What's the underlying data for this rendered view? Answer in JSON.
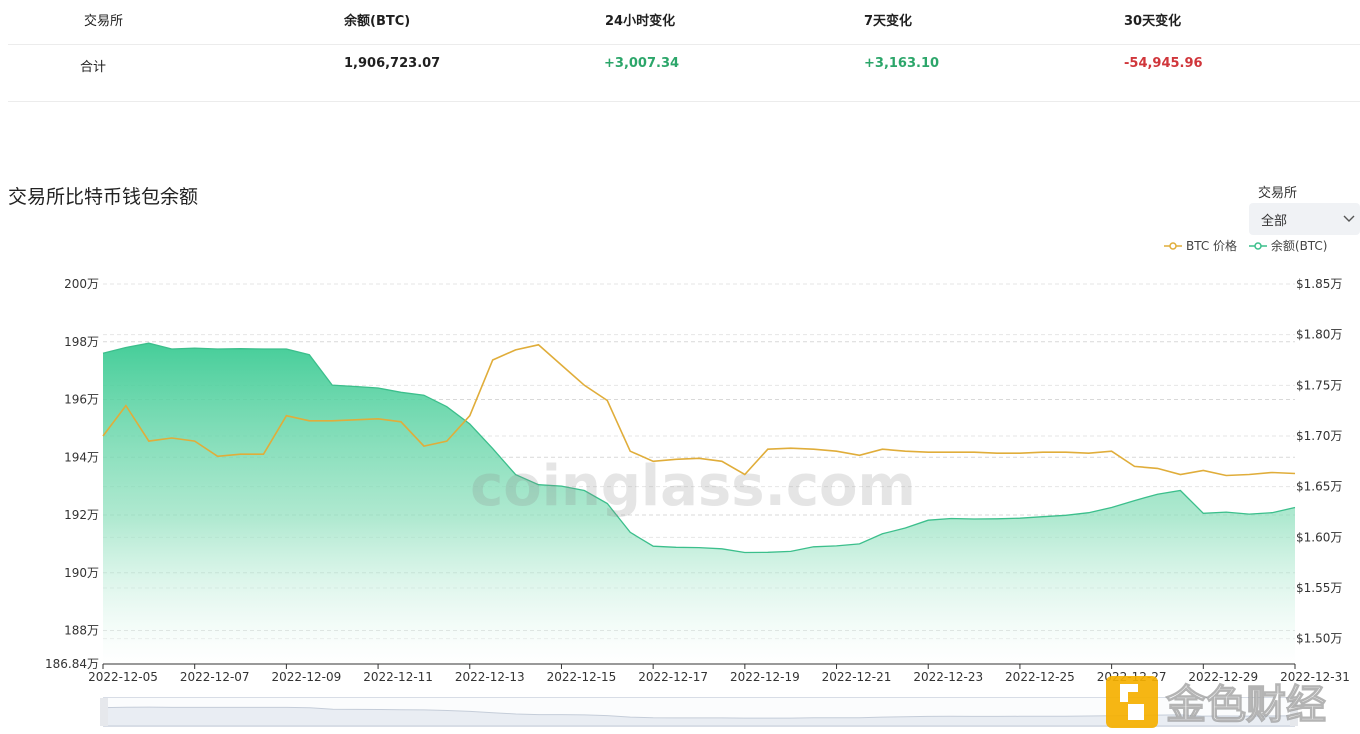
{
  "summary": {
    "headers": {
      "exchange": "交易所",
      "balance": "余额(BTC)",
      "change_24h": "24小时变化",
      "change_7d": "7天变化",
      "change_30d": "30天变化"
    },
    "total_row": {
      "label": "合计",
      "balance": "1,906,723.07",
      "change_24h": "+3,007.34",
      "change_7d": "+3,163.10",
      "change_30d": "-54,945.96"
    }
  },
  "chart_title": "交易所比特币钱包余额",
  "filter": {
    "label": "交易所",
    "value": "全部"
  },
  "watermark": "coinglass.com",
  "logo_text": "金色财经",
  "colors": {
    "btc_price": "#e0ad3a",
    "balance_line": "#3cbf8c",
    "balance_fill_top": "#3ccb94",
    "balance_fill_bottom": "#ffffff",
    "positive": "#2ca66a",
    "negative": "#d0363b"
  },
  "chart_data": {
    "type": "area",
    "title": "交易所比特币钱包余额",
    "legend": [
      "BTC 价格",
      "余额(BTC)"
    ],
    "legend_placement": "top-right",
    "x_tick_labels": [
      "2022-12-05",
      "2022-12-07",
      "2022-12-09",
      "2022-12-11",
      "2022-12-13",
      "2022-12-15",
      "2022-12-17",
      "2022-12-19",
      "2022-12-21",
      "2022-12-23",
      "2022-12-25",
      "2022-12-27",
      "2022-12-29",
      "2022-12-31"
    ],
    "y_left_tick_labels": [
      "186.84万",
      "188万",
      "190万",
      "192万",
      "194万",
      "196万",
      "198万",
      "200万"
    ],
    "y_right_tick_labels": [
      "$1.50万",
      "$1.55万",
      "$1.60万",
      "$1.65万",
      "$1.70万",
      "$1.75万",
      "$1.80万",
      "$1.85万"
    ],
    "y_left_range": [
      1868400,
      2000000
    ],
    "y_right_range": [
      14750,
      18500
    ],
    "x_range": [
      "2022-12-05",
      "2022-12-31"
    ],
    "grid": true,
    "series": [
      {
        "name": "余额(BTC)",
        "axis": "left",
        "type": "area",
        "x": [
          "2022-12-05",
          "2022-12-05 12:00",
          "2022-12-06",
          "2022-12-06 12:00",
          "2022-12-07",
          "2022-12-07 12:00",
          "2022-12-08",
          "2022-12-08 12:00",
          "2022-12-09",
          "2022-12-09 12:00",
          "2022-12-10",
          "2022-12-10 12:00",
          "2022-12-11",
          "2022-12-11 12:00",
          "2022-12-12",
          "2022-12-12 12:00",
          "2022-12-13",
          "2022-12-13 12:00",
          "2022-12-14",
          "2022-12-14 12:00",
          "2022-12-15",
          "2022-12-15 12:00",
          "2022-12-16",
          "2022-12-16 12:00",
          "2022-12-17",
          "2022-12-17 12:00",
          "2022-12-18",
          "2022-12-18 12:00",
          "2022-12-19",
          "2022-12-19 12:00",
          "2022-12-20",
          "2022-12-20 12:00",
          "2022-12-21",
          "2022-12-21 12:00",
          "2022-12-22",
          "2022-12-22 12:00",
          "2022-12-23",
          "2022-12-23 12:00",
          "2022-12-24",
          "2022-12-24 12:00",
          "2022-12-25",
          "2022-12-25 12:00",
          "2022-12-26",
          "2022-12-26 12:00",
          "2022-12-27",
          "2022-12-27 12:00",
          "2022-12-28",
          "2022-12-28 12:00",
          "2022-12-29",
          "2022-12-29 12:00",
          "2022-12-30",
          "2022-12-30 12:00",
          "2022-12-31"
        ],
        "values": [
          1976000,
          1978000,
          1979500,
          1977500,
          1977800,
          1977500,
          1977600,
          1977500,
          1977500,
          1975500,
          1965000,
          1964500,
          1964000,
          1962500,
          1961500,
          1957500,
          1951500,
          1943000,
          1934000,
          1930500,
          1930000,
          1928500,
          1924000,
          1914000,
          1909200,
          1908800,
          1908700,
          1908300,
          1907000,
          1907100,
          1907400,
          1909000,
          1909300,
          1910000,
          1913500,
          1915500,
          1918200,
          1918800,
          1918600,
          1918700,
          1918900,
          1919400,
          1919900,
          1920800,
          1922600,
          1925000,
          1927200,
          1928500,
          1920600,
          1921000,
          1920300,
          1920800,
          1922600
        ]
      },
      {
        "name": "BTC 价格",
        "axis": "right",
        "type": "line",
        "x": [
          "2022-12-05",
          "2022-12-05 12:00",
          "2022-12-06",
          "2022-12-06 12:00",
          "2022-12-07",
          "2022-12-07 12:00",
          "2022-12-08",
          "2022-12-08 12:00",
          "2022-12-09",
          "2022-12-09 12:00",
          "2022-12-10",
          "2022-12-10 12:00",
          "2022-12-11",
          "2022-12-11 12:00",
          "2022-12-12",
          "2022-12-12 12:00",
          "2022-12-13",
          "2022-12-13 12:00",
          "2022-12-14",
          "2022-12-14 12:00",
          "2022-12-15",
          "2022-12-15 12:00",
          "2022-12-16",
          "2022-12-16 12:00",
          "2022-12-17",
          "2022-12-17 12:00",
          "2022-12-18",
          "2022-12-18 12:00",
          "2022-12-19",
          "2022-12-19 12:00",
          "2022-12-20",
          "2022-12-20 12:00",
          "2022-12-21",
          "2022-12-21 12:00",
          "2022-12-22",
          "2022-12-22 12:00",
          "2022-12-23",
          "2022-12-23 12:00",
          "2022-12-24",
          "2022-12-24 12:00",
          "2022-12-25",
          "2022-12-25 12:00",
          "2022-12-26",
          "2022-12-26 12:00",
          "2022-12-27",
          "2022-12-27 12:00",
          "2022-12-28",
          "2022-12-28 12:00",
          "2022-12-29",
          "2022-12-29 12:00",
          "2022-12-30",
          "2022-12-30 12:00",
          "2022-12-31"
        ],
        "values": [
          17000,
          17300,
          16950,
          16980,
          16950,
          16800,
          16820,
          16820,
          17200,
          17150,
          17150,
          17160,
          17170,
          17140,
          16900,
          16950,
          17200,
          17750,
          17850,
          17900,
          17700,
          17500,
          17350,
          16850,
          16750,
          16770,
          16780,
          16750,
          16620,
          16870,
          16880,
          16870,
          16850,
          16810,
          16870,
          16850,
          16840,
          16840,
          16840,
          16830,
          16830,
          16840,
          16840,
          16830,
          16850,
          16700,
          16680,
          16620,
          16660,
          16610,
          16620,
          16640,
          16630
        ]
      }
    ]
  }
}
